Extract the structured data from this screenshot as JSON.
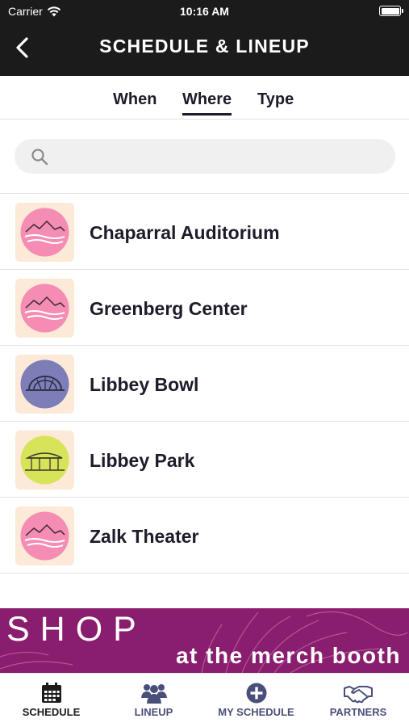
{
  "status_bar": {
    "carrier": "Carrier",
    "time": "10:16 AM"
  },
  "nav": {
    "title": "SCHEDULE & LINEUP",
    "back_icon": "chevron-left-icon"
  },
  "tabs": [
    {
      "label": "When",
      "active": false
    },
    {
      "label": "Where",
      "active": true
    },
    {
      "label": "Type",
      "active": false
    }
  ],
  "search": {
    "placeholder": "",
    "value": "",
    "icon": "search-icon"
  },
  "venues": [
    {
      "name": "Chaparral Auditorium",
      "thumb_color": "#f48cb3",
      "thumb_icon": "mountains-icon"
    },
    {
      "name": "Greenberg Center",
      "thumb_color": "#f48cb3",
      "thumb_icon": "mountains-icon"
    },
    {
      "name": "Libbey Bowl",
      "thumb_color": "#7d7db8",
      "thumb_icon": "bandshell-icon"
    },
    {
      "name": "Libbey Park",
      "thumb_color": "#d7e45a",
      "thumb_icon": "pavilion-icon"
    },
    {
      "name": "Zalk Theater",
      "thumb_color": "#f48cb3",
      "thumb_icon": "mountains-icon"
    }
  ],
  "banner": {
    "title": "SHOP",
    "subtitle": "at the merch booth",
    "bg_color": "#8a1e6e"
  },
  "tab_bar": [
    {
      "label": "SCHEDULE",
      "icon": "calendar-icon",
      "active": true
    },
    {
      "label": "LINEUP",
      "icon": "people-icon",
      "active": false
    },
    {
      "label": "MY SCHEDULE",
      "icon": "plus-circle-icon",
      "active": false
    },
    {
      "label": "PARTNERS",
      "icon": "handshake-icon",
      "active": false
    }
  ]
}
